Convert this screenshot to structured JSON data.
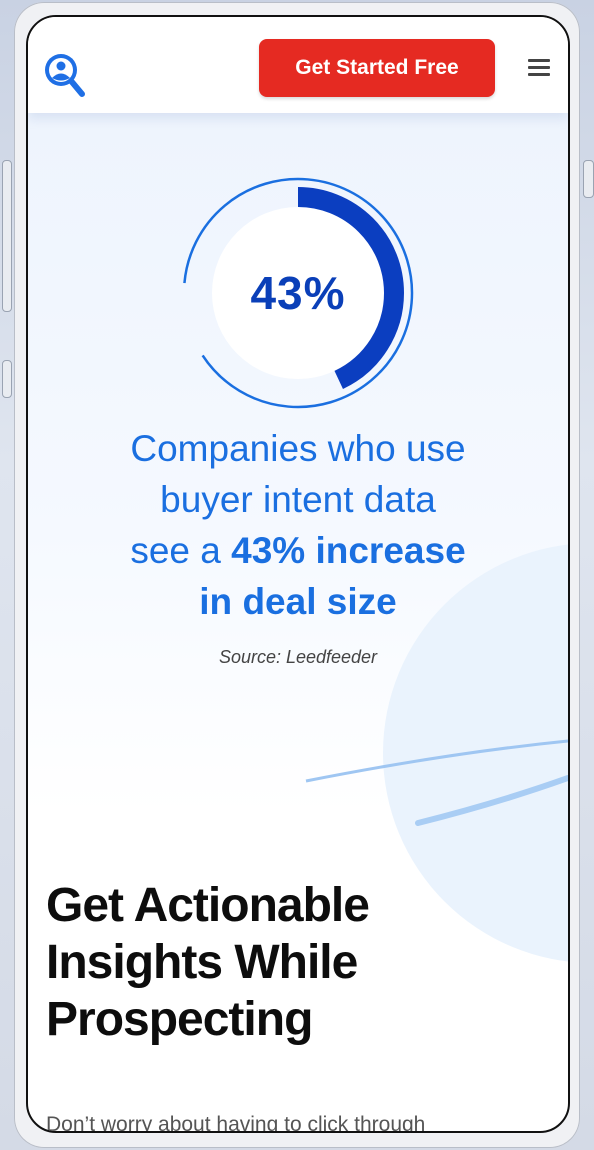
{
  "header": {
    "logo_icon": "magnifier-user-icon",
    "cta_label": "Get Started Free",
    "menu_icon": "hamburger-menu-icon"
  },
  "stat": {
    "percent_label": "43%",
    "percent_value": 43,
    "line1": "Companies who use",
    "line2": "buyer intent data",
    "line3_prefix": "see a ",
    "line3_bold": "43% increase",
    "line4_bold": "in deal size",
    "source": "Source: Leedfeeder"
  },
  "section": {
    "heading_line1": "Get Actionable",
    "heading_line2": "Insights While",
    "heading_line3": "Prospecting",
    "intro": "Don’t worry about having to click through"
  },
  "colors": {
    "cta": "#e52a22",
    "accent_dark_blue": "#0a3fb8",
    "accent_blue": "#1a6fe0"
  }
}
